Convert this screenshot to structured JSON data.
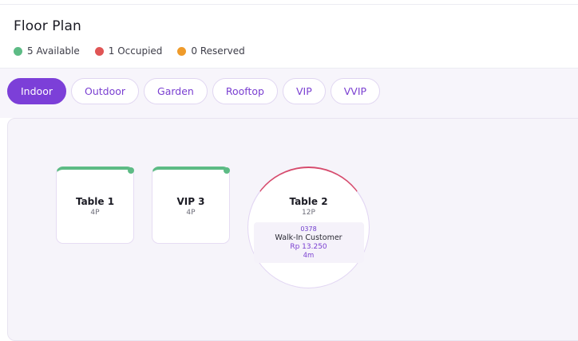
{
  "header": {
    "title": "Floor Plan",
    "legend": [
      {
        "label": "5 Available",
        "color": "#5dbb85"
      },
      {
        "label": "1 Occupied",
        "color": "#e05555"
      },
      {
        "label": "0 Reserved",
        "color": "#ef9b2b"
      }
    ]
  },
  "tabs": [
    {
      "label": "Indoor",
      "active": true
    },
    {
      "label": "Outdoor",
      "active": false
    },
    {
      "label": "Garden",
      "active": false
    },
    {
      "label": "Rooftop",
      "active": false
    },
    {
      "label": "VIP",
      "active": false
    },
    {
      "label": "VVIP",
      "active": false
    }
  ],
  "tables": {
    "table1": {
      "name": "Table 1",
      "capacity": "4P",
      "status": "available"
    },
    "vip3": {
      "name": "VIP 3",
      "capacity": "4P",
      "status": "available"
    },
    "table2": {
      "name": "Table 2",
      "capacity": "12P",
      "status": "occupied",
      "order": {
        "id": "0378",
        "customer": "Walk-In Customer",
        "amount": "Rp 13.250",
        "elapsed": "4m"
      }
    }
  },
  "colors": {
    "accent": "#7c3fd8",
    "available": "#5dbb85",
    "occupied": "#d64b6d",
    "reserved": "#ef9b2b"
  }
}
